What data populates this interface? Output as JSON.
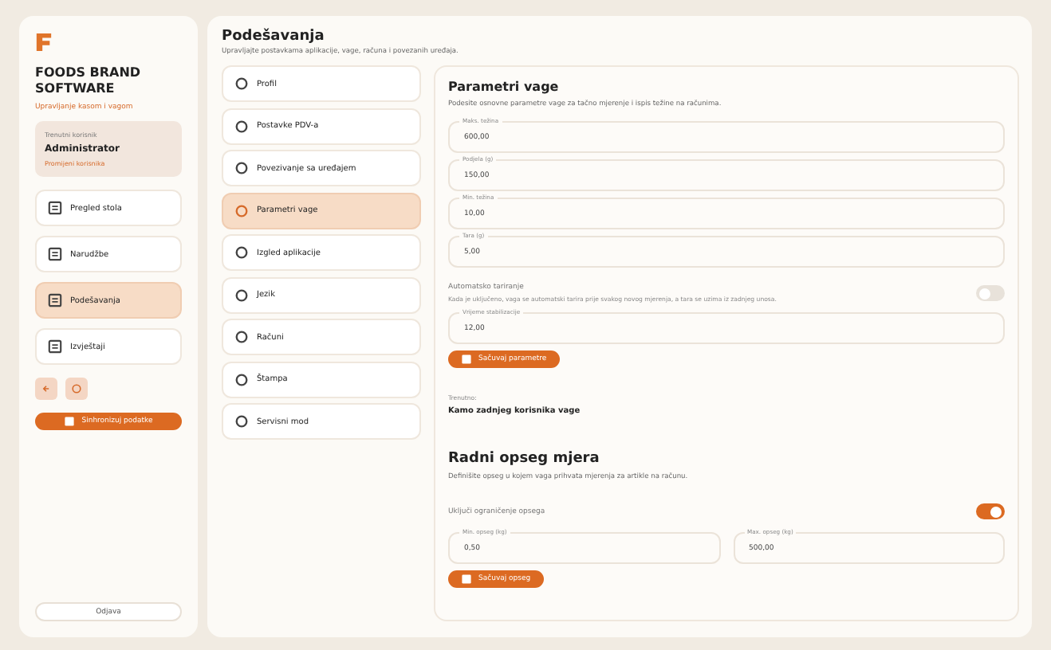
{
  "brand": {
    "name": "FOODS BRAND SOFTWARE",
    "tagline": "Upravljanje kasom i vagom"
  },
  "user_card": {
    "label": "Trenutni korisnik",
    "name": "Administrator",
    "link": "Promijeni korisnika"
  },
  "nav": [
    {
      "label": "Pregled stola",
      "selected": false
    },
    {
      "label": "Narudžbe",
      "selected": false
    },
    {
      "label": "Podešavanja",
      "selected": true
    },
    {
      "label": "Izvještaji",
      "selected": false
    }
  ],
  "sync_button": "Sinhronizuj podatke",
  "logout_button": "Odjava",
  "page": {
    "title": "Podešavanja",
    "subtitle": "Upravljajte postavkama aplikacije, vage, računa i povezanih uređaja."
  },
  "settings_menu": [
    {
      "label": "Profil",
      "selected": false
    },
    {
      "label": "Postavke PDV-a",
      "selected": false
    },
    {
      "label": "Povezivanje sa uređajem",
      "selected": false
    },
    {
      "label": "Parametri vage",
      "selected": true
    },
    {
      "label": "Izgled aplikacije",
      "selected": false
    },
    {
      "label": "Jezik",
      "selected": false
    },
    {
      "label": "Računi",
      "selected": false
    },
    {
      "label": "Štampa",
      "selected": false
    },
    {
      "label": "Servisni mod",
      "selected": false
    }
  ],
  "scale_params": {
    "title": "Parametri vage",
    "description": "Podesite osnovne parametre vage za tačno mjerenje i ispis težine na računima.",
    "fields": [
      {
        "label": "Maks. težina",
        "value": "600,00"
      },
      {
        "label": "Podjela (g)",
        "value": "150,00"
      },
      {
        "label": "Min. težina",
        "value": "10,00"
      },
      {
        "label": "Tara (g)",
        "value": "5,00"
      }
    ],
    "toggle": {
      "label": "Automatsko tariranje",
      "description": "Kada je uključeno, vaga se automatski tarira prije svakog novog mjerenja, a tara se uzima iz zadnjeg unosa.",
      "on": false
    },
    "extra_field": {
      "label": "Vrijeme stabilizacije",
      "value": "12,00"
    },
    "save_button": "Sačuvaj parametre",
    "current_label": "Trenutno:",
    "current_value": "Kamo zadnjeg korisnika vage"
  },
  "range": {
    "title": "Radni opseg mjera",
    "description": "Definišite opseg u kojem vaga prihvata mjerenja za artikle na računu.",
    "toggle": {
      "label": "Uključi ograničenje opsega",
      "on": true
    },
    "fields": [
      {
        "label": "Min. opseg (kg)",
        "value": "0,50"
      },
      {
        "label": "Max. opseg (kg)",
        "value": "500,00"
      }
    ],
    "save_button": "Sačuvaj opseg"
  }
}
